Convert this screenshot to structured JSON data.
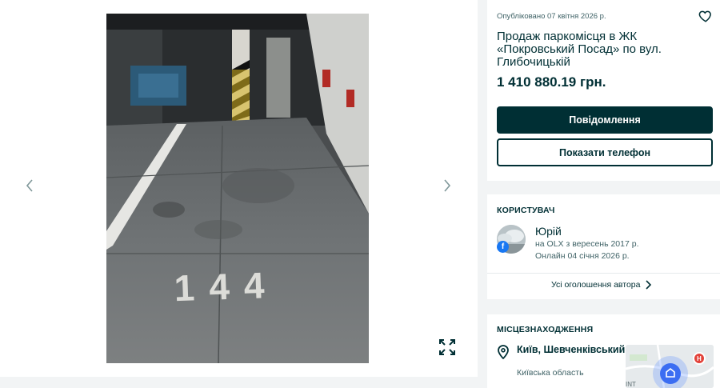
{
  "listing": {
    "published": "Опубліковано 07 квітня 2026 р.",
    "title": "Продаж паркомісця в ЖК «Покровський Посад» по вул. Глибочицькій",
    "price": "1 410 880.19 грн.",
    "message_button": "Повідомлення",
    "phone_button": "Показати телефон"
  },
  "photo": {
    "spot_number": "144"
  },
  "user": {
    "section_title": "КОРИСТУВАЧ",
    "name": "Юрій",
    "member_since": "на OLX з вересень 2017 р.",
    "last_online": "Онлайн 04 січня 2026 р.",
    "all_ads_link": "Усі оголошення автора"
  },
  "location": {
    "section_title": "МІСЦЕЗНАХОДЖЕННЯ",
    "city": "Київ, Шевченківський",
    "region": "Київська область",
    "map_label": "INT"
  },
  "colors": {
    "brand_dark": "#002f34",
    "muted": "#406367",
    "background": "#f2f4f5"
  }
}
